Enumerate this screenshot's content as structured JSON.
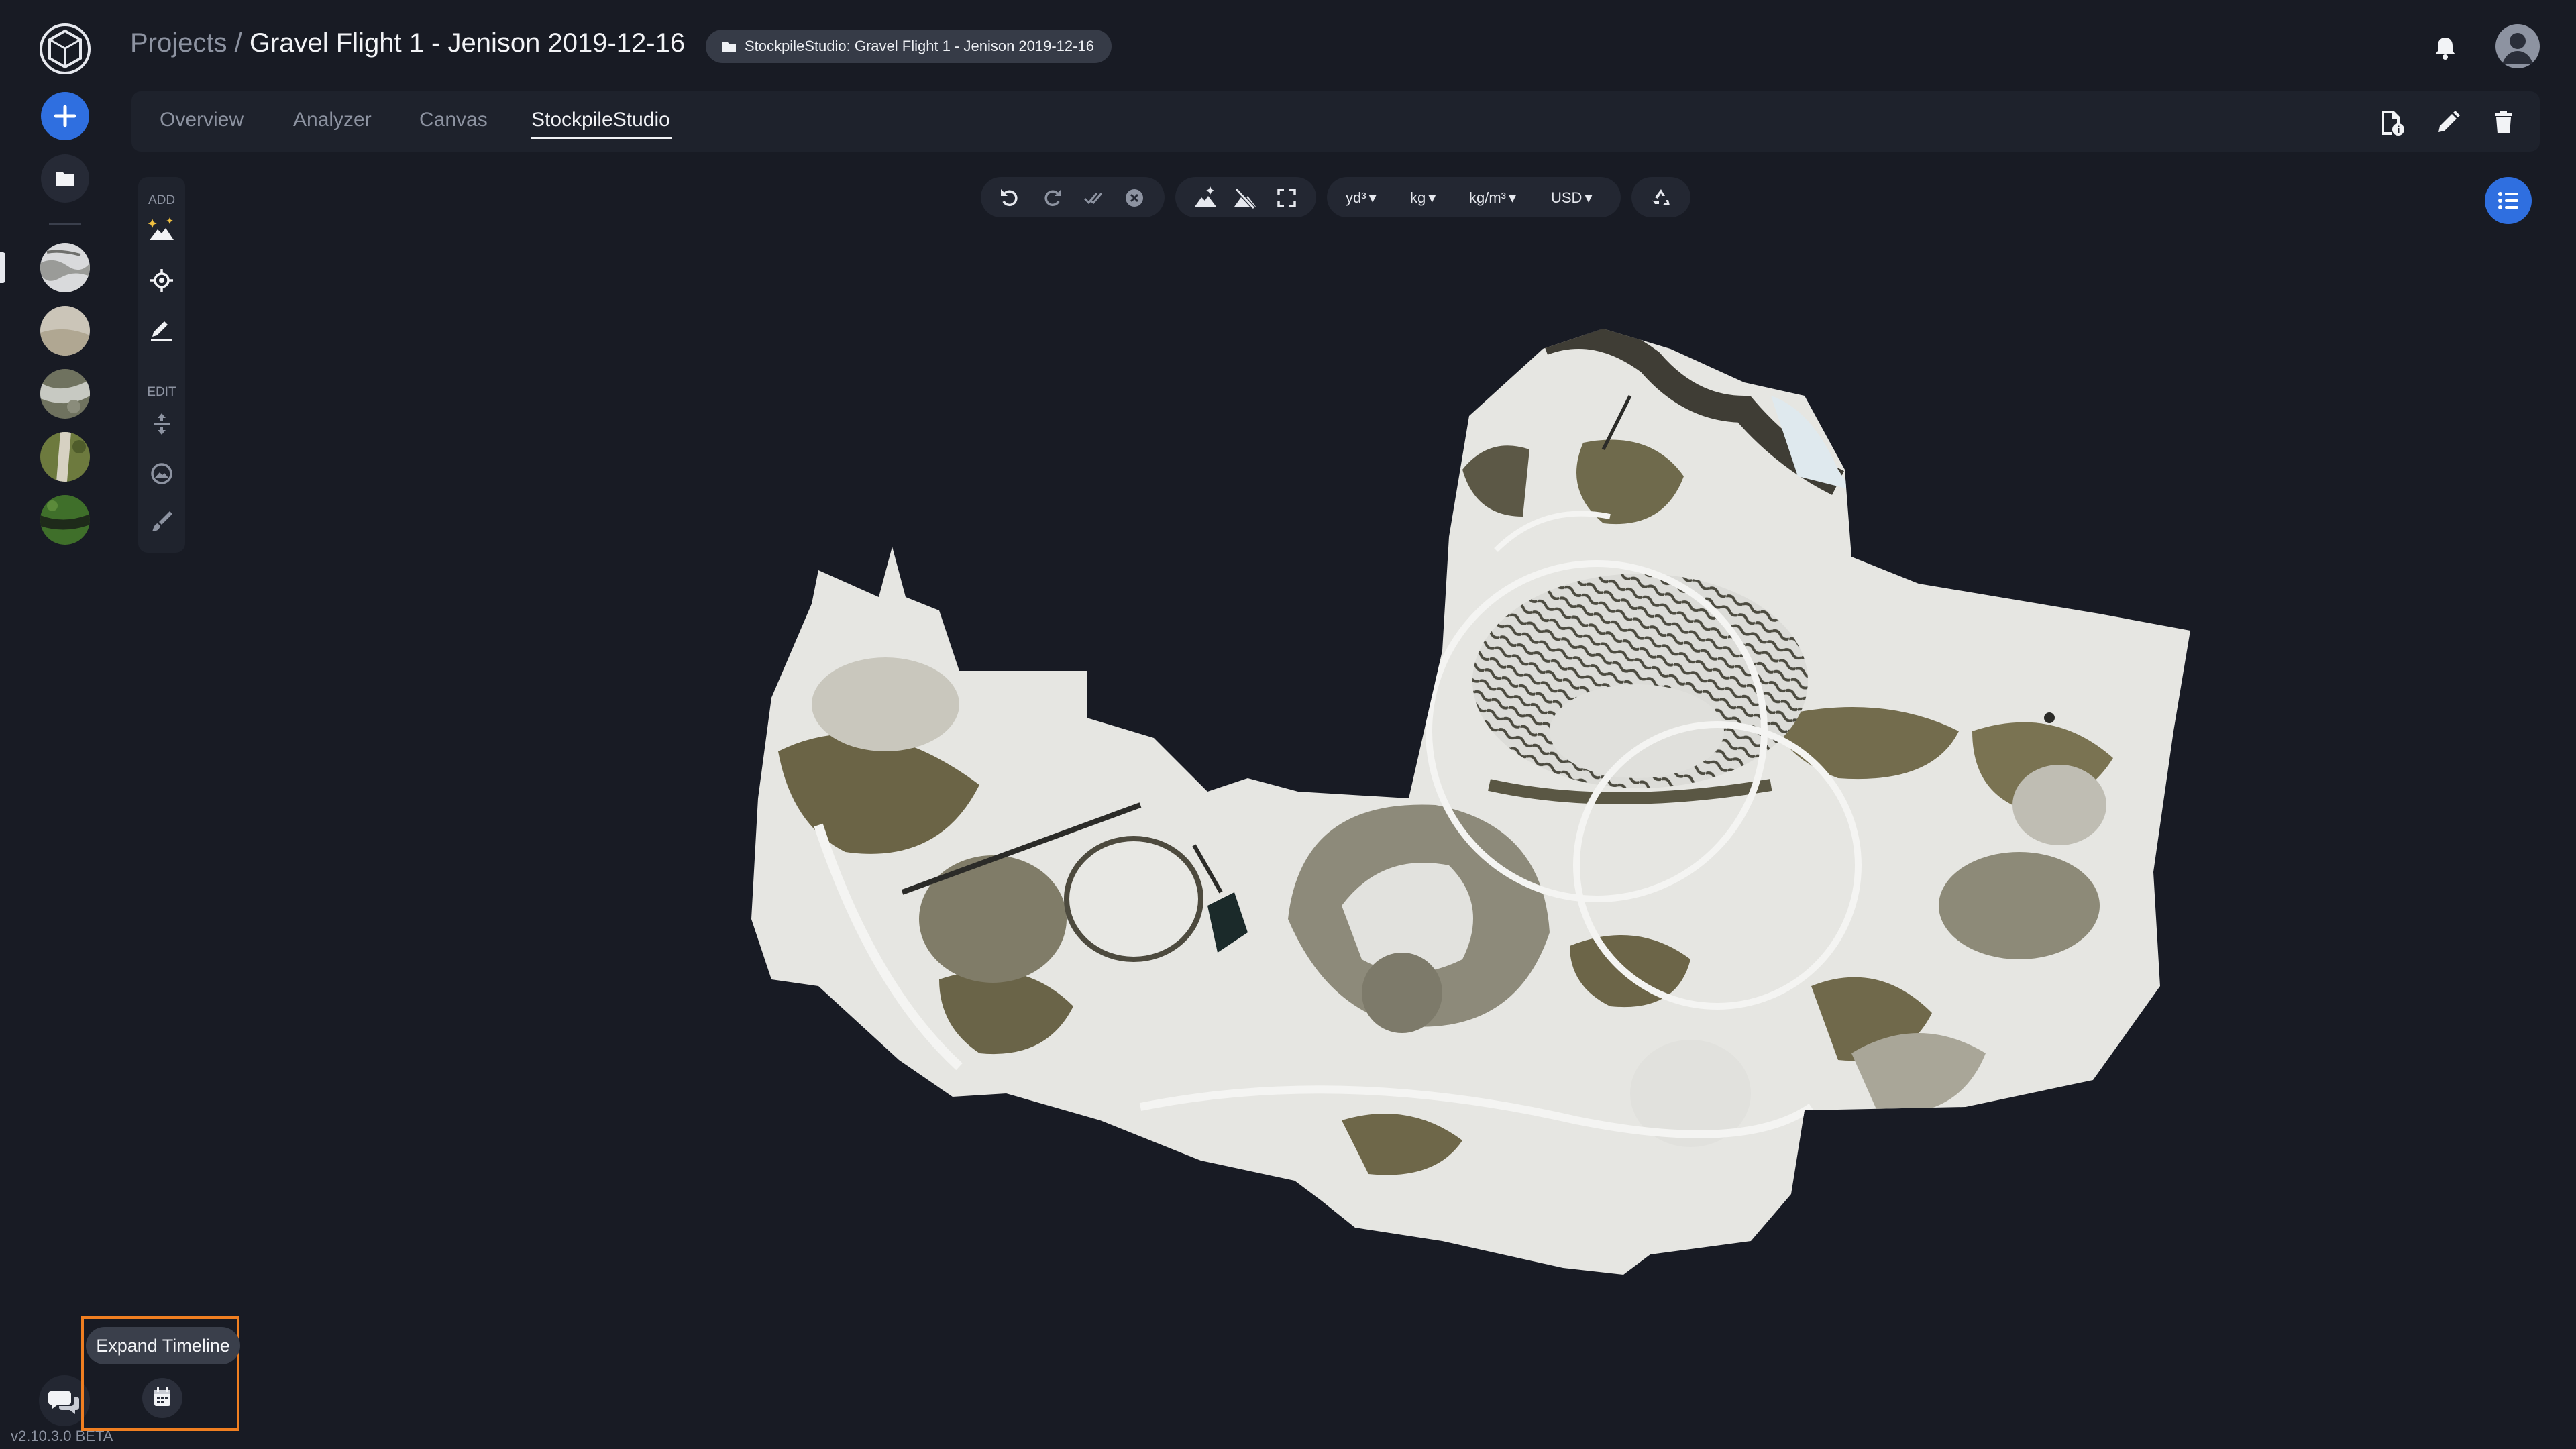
{
  "header": {
    "breadcrumb_parent": "Projects /",
    "title": "Gravel Flight 1 - Jenison 2019-12-16",
    "chip_label": "StockpileStudio: Gravel Flight 1 - Jenison 2019-12-16",
    "icons": [
      "app-logo-icon",
      "bell-icon",
      "user-avatar-icon",
      "folder-icon"
    ]
  },
  "tabs": [
    {
      "label": "Overview",
      "active": false
    },
    {
      "label": "Analyzer",
      "active": false
    },
    {
      "label": "Canvas",
      "active": false
    },
    {
      "label": "StockpileStudio",
      "active": true
    }
  ],
  "toolbox": {
    "add_label": "ADD",
    "edit_label": "EDIT"
  },
  "units": {
    "volume": "yd³",
    "mass": "kg",
    "density": "kg/m³",
    "currency": "USD"
  },
  "tooltip": {
    "text": "Expand Timeline"
  },
  "footer": {
    "version": "v2.10.3.0 BETA"
  },
  "colors": {
    "background": "#181b24",
    "accent": "#2f6fe0",
    "highlight": "#f07f21"
  }
}
